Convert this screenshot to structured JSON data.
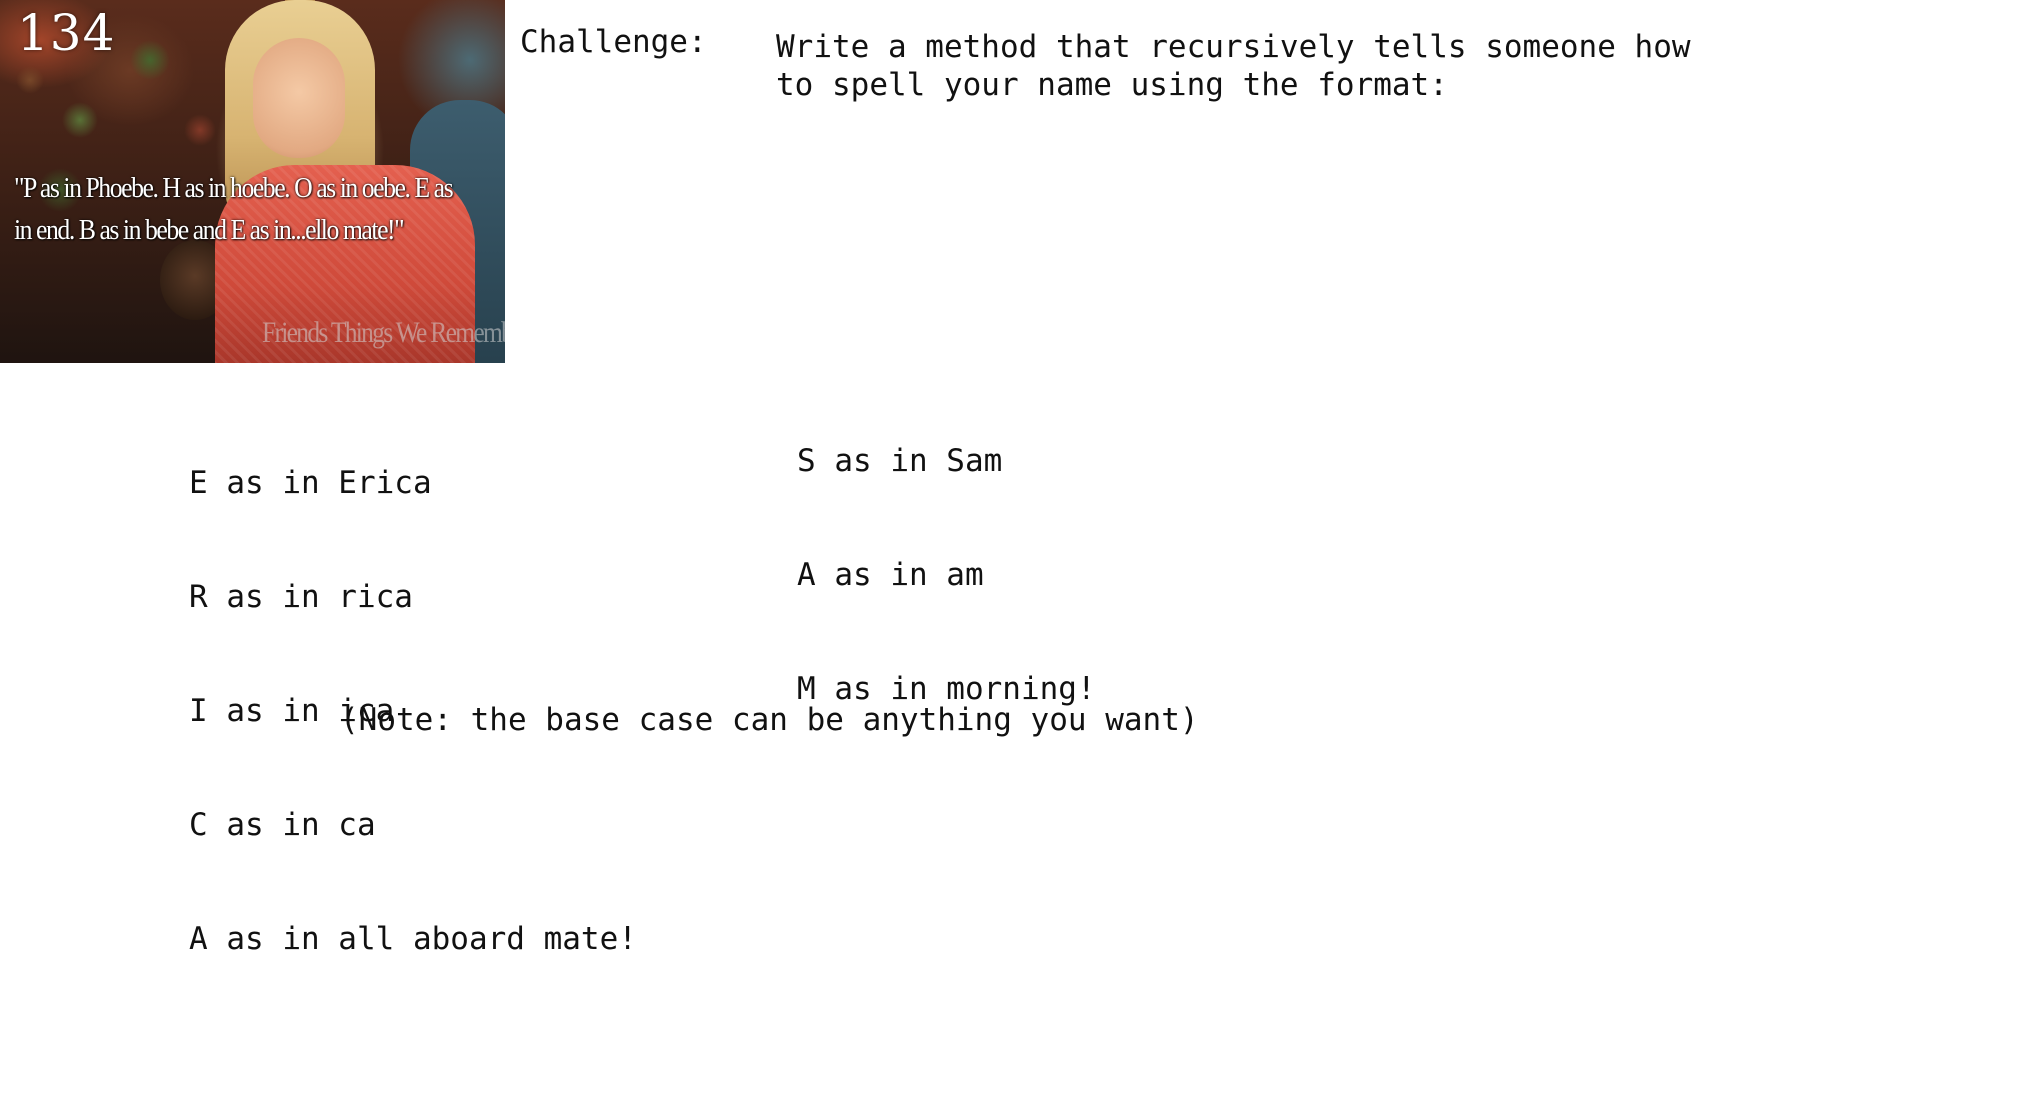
{
  "meme": {
    "number": "134",
    "quote": "\"P as in Phoebe. H as in hoebe. O as in oebe. E as in end. B as in bebe and E as in...ello mate!\"",
    "watermark": "Friends Things We Remember"
  },
  "challenge": {
    "label": "Challenge:",
    "text": "Write a method that recursively tells someone how\nto spell your name using the format:"
  },
  "examples": {
    "erica": [
      "E as in Erica",
      "R as in rica",
      "I as in ica",
      "C as in ca",
      "A as in all aboard mate!"
    ],
    "sam": [
      "S as in Sam",
      "A as in am",
      "M as in morning!"
    ]
  },
  "note": "(Note: the base case can be anything you want)"
}
